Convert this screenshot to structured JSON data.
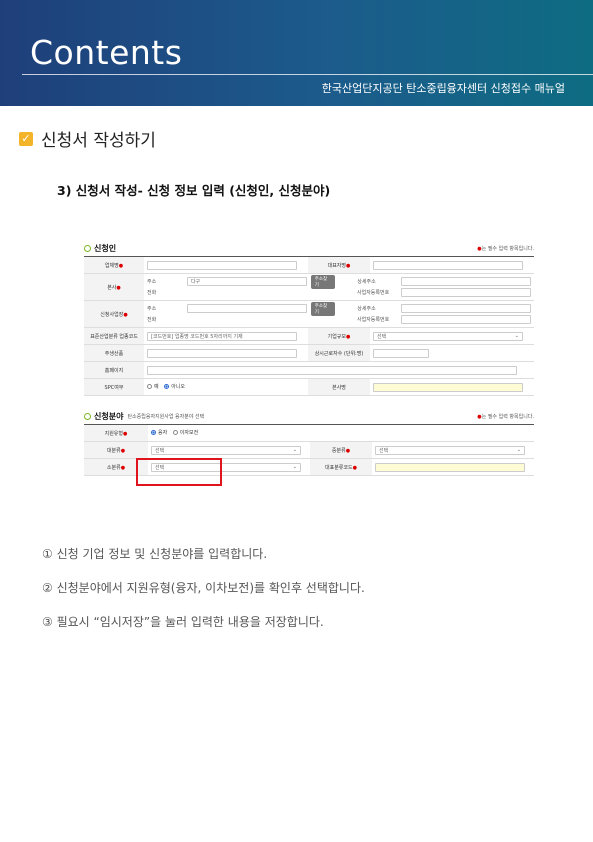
{
  "banner": {
    "title": "Contents",
    "subtitle": "한국산업단지공단 탄소중립융자센터 신청접수 매뉴얼"
  },
  "section": {
    "title": "신청서 작성하기",
    "check_icon": "✓"
  },
  "step": {
    "title": "3) 신청서 작성- 신청 정보 입력 (신청인, 신청분야)"
  },
  "applicant": {
    "heading": "신청인",
    "required_note": "는 필수 입력 항목입니다.",
    "req_mark": "●",
    "company_name": "업체명",
    "ceo": "대표자명",
    "hq": "본사",
    "address": "주소",
    "address_value": "다구",
    "find_address": "주소찾기",
    "detail_address": "상세주소",
    "phone": "전화",
    "biz_no": "사업자등록번호",
    "plant": "신청사업장",
    "industry": "표준산업분류 업종코드",
    "industry_placeholder": "[코드번호] 업종명  코드번호 5자리까지 기재",
    "company_scale": "기업규모",
    "select": "선택",
    "main_product": "주생산품",
    "employees": "상시근로자수 (단위:명)",
    "homepage": "홈페이지",
    "spc": "SPC여부",
    "spc_yes": "예",
    "spc_no": "아니오",
    "branch": "본사명"
  },
  "field": {
    "heading": "신청분야",
    "note": "탄소중립융자지원사업 융자분야 선택",
    "support_type": "지원유형",
    "loan": "융자",
    "interest": "이자보전",
    "major": "대분류",
    "middle": "중분류",
    "minor": "소분류",
    "rep_code": "대표분류코드",
    "select": "선택"
  },
  "instructions": [
    "① 신청 기업 정보 및 신청분야를 입력합니다.",
    "② 신청분야에서 지원유형(융자, 이차보전)를 확인후 선택합니다.",
    "③ 필요시 “임시저장”을 눌러 입력한 내용을 저장합니다."
  ]
}
